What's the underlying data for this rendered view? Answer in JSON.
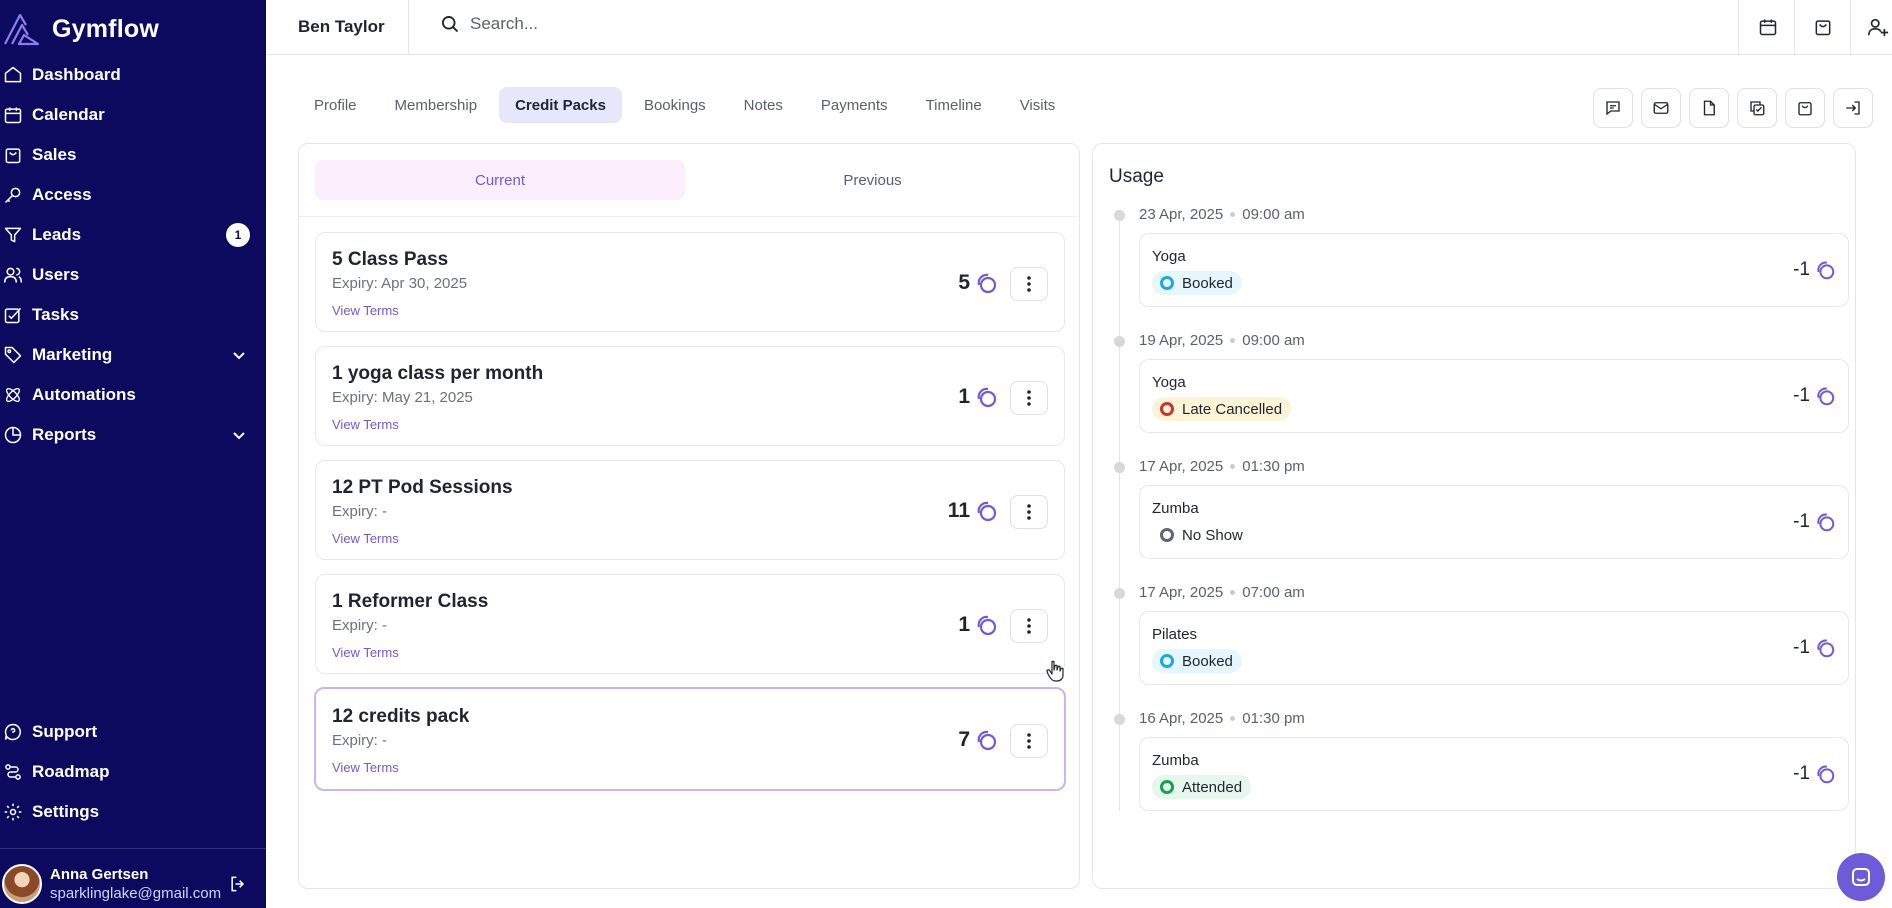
{
  "app": {
    "name": "Gymflow"
  },
  "sidebar": {
    "nav": [
      {
        "label": "Dashboard",
        "icon": "home-icon"
      },
      {
        "label": "Calendar",
        "icon": "calendar-icon"
      },
      {
        "label": "Sales",
        "icon": "shopping-bag-icon"
      },
      {
        "label": "Access",
        "icon": "key-icon"
      },
      {
        "label": "Leads",
        "icon": "funnel-icon",
        "badge": "1"
      },
      {
        "label": "Users",
        "icon": "users-icon"
      },
      {
        "label": "Tasks",
        "icon": "tasks-icon"
      },
      {
        "label": "Marketing",
        "icon": "tag-icon",
        "expandable": true
      },
      {
        "label": "Automations",
        "icon": "atom-icon"
      },
      {
        "label": "Reports",
        "icon": "pie-chart-icon",
        "expandable": true
      }
    ],
    "bottom_nav": [
      {
        "label": "Support",
        "icon": "chat-help-icon"
      },
      {
        "label": "Roadmap",
        "icon": "roadmap-icon"
      },
      {
        "label": "Settings",
        "icon": "gear-icon"
      }
    ],
    "user": {
      "name": "Anna Gertsen",
      "email": "sparklinglake@gmail.com"
    }
  },
  "topbar": {
    "member_name": "Ben Taylor",
    "search_placeholder": "Search...",
    "icons": [
      "calendar-icon",
      "shopping-bag-icon",
      "add-user-icon"
    ]
  },
  "tabs": [
    {
      "label": "Profile"
    },
    {
      "label": "Membership"
    },
    {
      "label": "Credit Packs",
      "active": true
    },
    {
      "label": "Bookings"
    },
    {
      "label": "Notes"
    },
    {
      "label": "Payments"
    },
    {
      "label": "Timeline"
    },
    {
      "label": "Visits"
    }
  ],
  "action_icons": [
    "message-icon",
    "mail-icon",
    "document-icon",
    "copy-check-icon",
    "shopping-bag-icon",
    "check-in-icon"
  ],
  "credit_packs": {
    "segments": {
      "current": "Current",
      "previous": "Previous"
    },
    "packs": [
      {
        "name": "5 Class Pass",
        "expiry": "Expiry: Apr 30, 2025",
        "credits": "5",
        "terms": "View Terms"
      },
      {
        "name": "1 yoga class per month",
        "expiry": "Expiry: May 21, 2025",
        "credits": "1",
        "terms": "View Terms"
      },
      {
        "name": "12 PT Pod Sessions",
        "expiry": "Expiry: -",
        "credits": "11",
        "terms": "View Terms"
      },
      {
        "name": "1 Reformer Class",
        "expiry": "Expiry: -",
        "credits": "1",
        "terms": "View Terms"
      },
      {
        "name": "12 credits pack",
        "expiry": "Expiry: -",
        "credits": "7",
        "terms": "View Terms",
        "selected": true
      }
    ]
  },
  "usage": {
    "title": "Usage",
    "entries": [
      {
        "date": "23 Apr, 2025",
        "time": "09:00 am",
        "class": "Yoga",
        "status": "Booked",
        "status_color": "#1ea7e6",
        "status_bg": "#e6f6fd",
        "credit": "-1"
      },
      {
        "date": "19 Apr, 2025",
        "time": "09:00 am",
        "class": "Yoga",
        "status": "Late Cancelled",
        "status_color": "#c9352a",
        "status_bg": "#fdf3d6",
        "credit": "-1"
      },
      {
        "date": "17 Apr, 2025",
        "time": "01:30 pm",
        "class": "Zumba",
        "status": "No Show",
        "status_color": "#5f6573",
        "status_bg": "#ffffff",
        "credit": "-1"
      },
      {
        "date": "17 Apr, 2025",
        "time": "07:00 am",
        "class": "Pilates",
        "status": "Booked",
        "status_color": "#1ea7e6",
        "status_bg": "#e6f6fd",
        "credit": "-1"
      },
      {
        "date": "16 Apr, 2025",
        "time": "01:30 pm",
        "class": "Zumba",
        "status": "Attended",
        "status_color": "#1f9d55",
        "status_bg": "#e6f7ee",
        "credit": "-1"
      }
    ]
  },
  "colors": {
    "sidebar": "#0c0a5e",
    "accent": "#6d5bd8",
    "active_tab": "#e7e7fb",
    "current_segment": "#fdeefd"
  }
}
